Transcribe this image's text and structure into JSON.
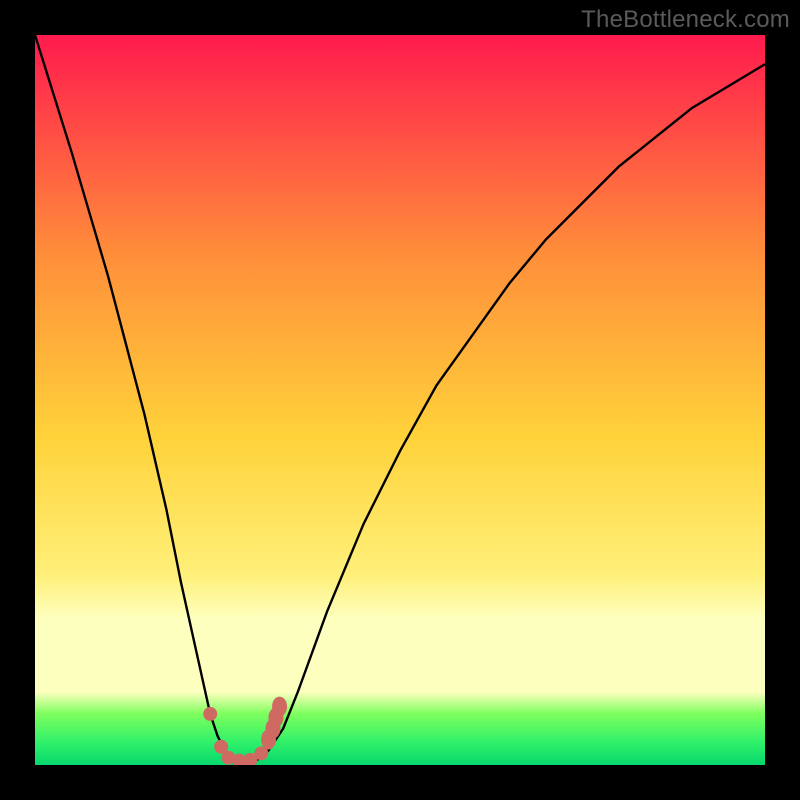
{
  "watermark": "TheBottleneck.com",
  "colors": {
    "top": "#ff1a4e",
    "mid_upper": "#ff8e3a",
    "mid": "#ffd23a",
    "mid_lower": "#fff07a",
    "pale_band": "#fdffbe",
    "green_top": "#7dff5e",
    "green_mid": "#2ef06a",
    "green_bottom": "#07d76d",
    "curve": "#000000",
    "marker": "#cf6a63",
    "marker_stroke": "#b85a55"
  },
  "chart_data": {
    "type": "line",
    "title": "",
    "xlabel": "",
    "ylabel": "",
    "xlim": [
      0,
      100
    ],
    "ylim": [
      0,
      100
    ],
    "series": [
      {
        "name": "bottleneck-curve",
        "x": [
          0,
          5,
          10,
          15,
          18,
          20,
          22,
          24,
          25,
          26,
          27,
          28,
          29,
          30,
          31,
          32,
          34,
          36,
          40,
          45,
          50,
          55,
          60,
          65,
          70,
          75,
          80,
          85,
          90,
          95,
          100
        ],
        "y": [
          100,
          84,
          67,
          48,
          35,
          25,
          16,
          7,
          4,
          2,
          1,
          0.5,
          0.5,
          0.5,
          1,
          2,
          5,
          10,
          21,
          33,
          43,
          52,
          59,
          66,
          72,
          77,
          82,
          86,
          90,
          93,
          96
        ]
      }
    ],
    "markers": [
      {
        "x": 24.0,
        "y": 7.0
      },
      {
        "x": 25.5,
        "y": 2.5
      },
      {
        "x": 26.5,
        "y": 1.0
      },
      {
        "x": 28.0,
        "y": 0.6
      },
      {
        "x": 29.5,
        "y": 0.7
      },
      {
        "x": 31.0,
        "y": 1.6
      },
      {
        "x": 32.0,
        "y": 3.5
      },
      {
        "x": 32.6,
        "y": 5.0
      },
      {
        "x": 33.0,
        "y": 6.5
      },
      {
        "x": 33.5,
        "y": 8.0
      }
    ],
    "optimal_x": 28.5
  }
}
